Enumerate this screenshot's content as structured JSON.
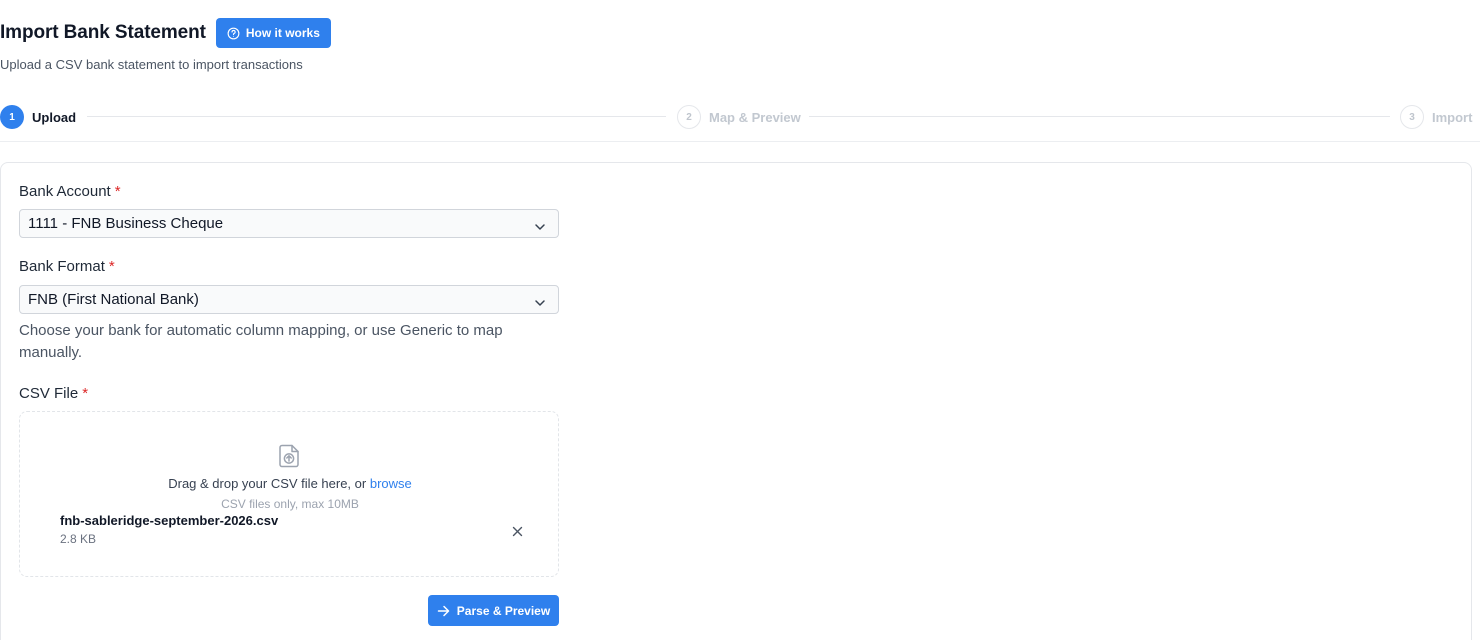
{
  "header": {
    "title": "Import Bank Statement",
    "help_button": "How it works",
    "subtitle": "Upload a CSV bank statement to import transactions"
  },
  "stepper": {
    "steps": [
      {
        "number": "1",
        "label": "Upload",
        "state": "active"
      },
      {
        "number": "2",
        "label": "Map & Preview",
        "state": "inactive"
      },
      {
        "number": "3",
        "label": "Import",
        "state": "inactive"
      }
    ]
  },
  "form": {
    "bank_account": {
      "label": "Bank Account",
      "required_mark": "*",
      "value": "1111 - FNB Business Cheque"
    },
    "bank_format": {
      "label": "Bank Format",
      "required_mark": "*",
      "value": "FNB (First National Bank)",
      "help": "Choose your bank for automatic column mapping, or use Generic to map manually."
    },
    "csv_file": {
      "label": "CSV File",
      "required_mark": "*",
      "drop_text": "Drag & drop your CSV file here, or",
      "browse_label": "browse",
      "hint": "CSV files only, max 10MB",
      "file_name": "fnb-sableridge-september-2026.csv",
      "file_size": "2.8 KB"
    },
    "submit_label": "Parse & Preview"
  },
  "colors": {
    "accent": "#2f80ed",
    "required": "#dc2626",
    "muted_text": "#4b5563",
    "border": "#e5e7eb"
  },
  "icons": {
    "help": "question-circle-icon",
    "select_caret": "chevron-down-icon",
    "upload": "file-upload-icon",
    "remove": "close-icon",
    "submit": "arrow-right-icon"
  }
}
